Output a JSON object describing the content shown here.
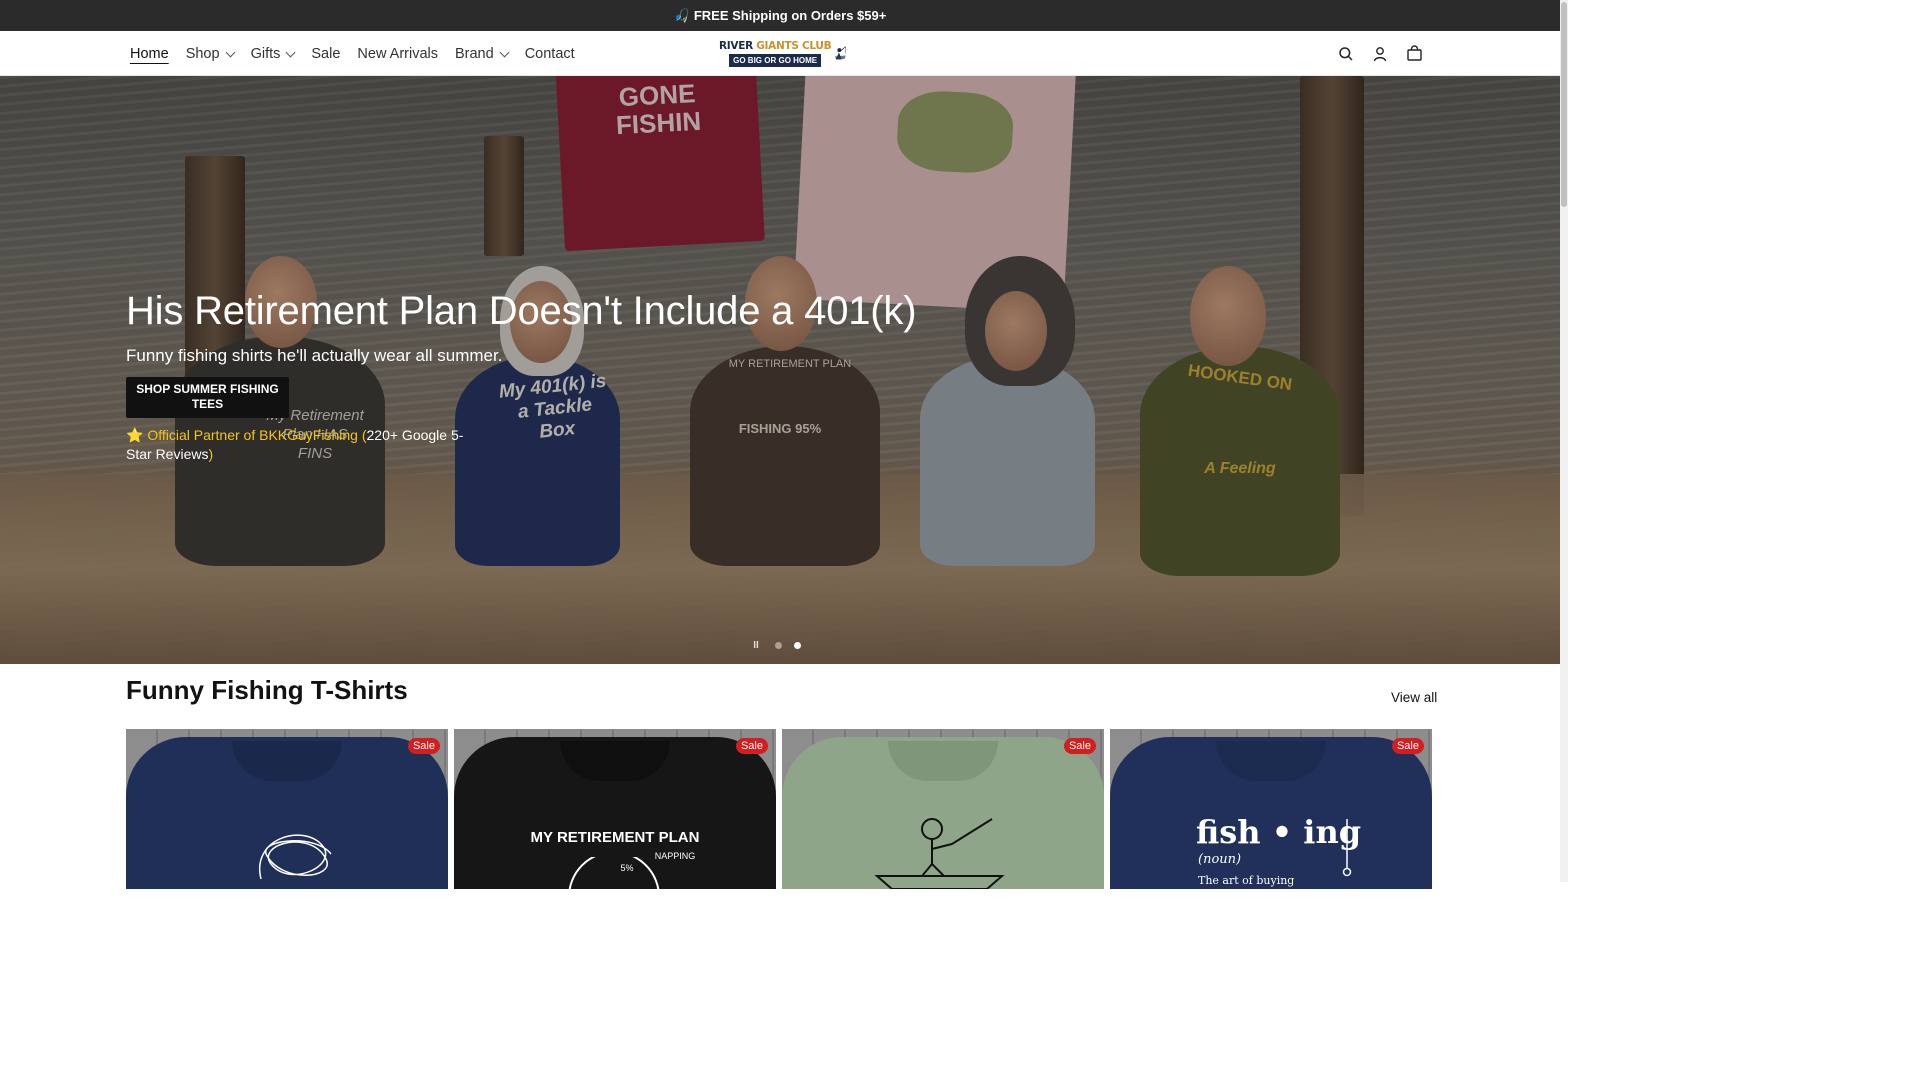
{
  "announcement": {
    "icon": "🎣",
    "text": "FREE Shipping on Orders $59+"
  },
  "nav": {
    "items": [
      {
        "label": "Home",
        "active": true,
        "has_dropdown": false
      },
      {
        "label": "Shop",
        "active": false,
        "has_dropdown": true
      },
      {
        "label": "Gifts",
        "active": false,
        "has_dropdown": true
      },
      {
        "label": "Sale",
        "active": false,
        "has_dropdown": false
      },
      {
        "label": "New Arrivals",
        "active": false,
        "has_dropdown": false
      },
      {
        "label": "Brand",
        "active": false,
        "has_dropdown": true
      },
      {
        "label": "Contact",
        "active": false,
        "has_dropdown": false
      }
    ]
  },
  "logo": {
    "line1_a": "RIVER ",
    "line1_b": "GIANTS CLUB",
    "line2": "GO BIG OR GO HOME"
  },
  "header_icons": [
    "search-icon",
    "account-icon",
    "cart-icon"
  ],
  "hero": {
    "title": "His Retirement Plan Doesn't Include a 401(k)",
    "subtitle": "Funny fishing shirts he'll actually wear all summer.",
    "button_label": "SHOP SUMMER FISHING TEES",
    "partner_star": "⭐",
    "partner_link": "Official Partner of BKKGuyFishing",
    "partner_paren_open": " (",
    "partner_text": "220+ Google 5-Star Reviews",
    "partner_paren_close": ")",
    "slides": 2,
    "active_slide": 2,
    "pause_label": "II",
    "shirt_texts": {
      "red_shirt": "GONE FISHIN",
      "left_shirt": "My Retirement Plan HAS FINS",
      "navy_shirt": "My 401(k) is a Tackle Box",
      "brown_shirt": "MY RETIREMENT PLAN",
      "brown_shirt_sub": "FISHING 95%",
      "green_shirt": "HOOKED ON",
      "green_shirt_sub": "A Feeling"
    }
  },
  "collection": {
    "title": "Funny Fishing T-Shirts",
    "view_all": "View all",
    "products": [
      {
        "color": "#1f2f57",
        "badge": "Sale",
        "print": ""
      },
      {
        "color": "#161616",
        "badge": "Sale",
        "print": "MY RETIREMENT PLAN",
        "print_sub": "NAPPING",
        "print_pct": "5%"
      },
      {
        "color": "#8fa58a",
        "badge": "Sale",
        "print": ""
      },
      {
        "color": "#20305a",
        "badge": "Sale",
        "print": "fish • ing",
        "print_sub": "(noun)",
        "print_line": "The art of buying"
      }
    ]
  },
  "colors": {
    "announcement_bg": "#2b2b2b",
    "sale_badge": "#d21e1e",
    "partner_gold": "#f5c518",
    "button_bg": "#111111"
  }
}
